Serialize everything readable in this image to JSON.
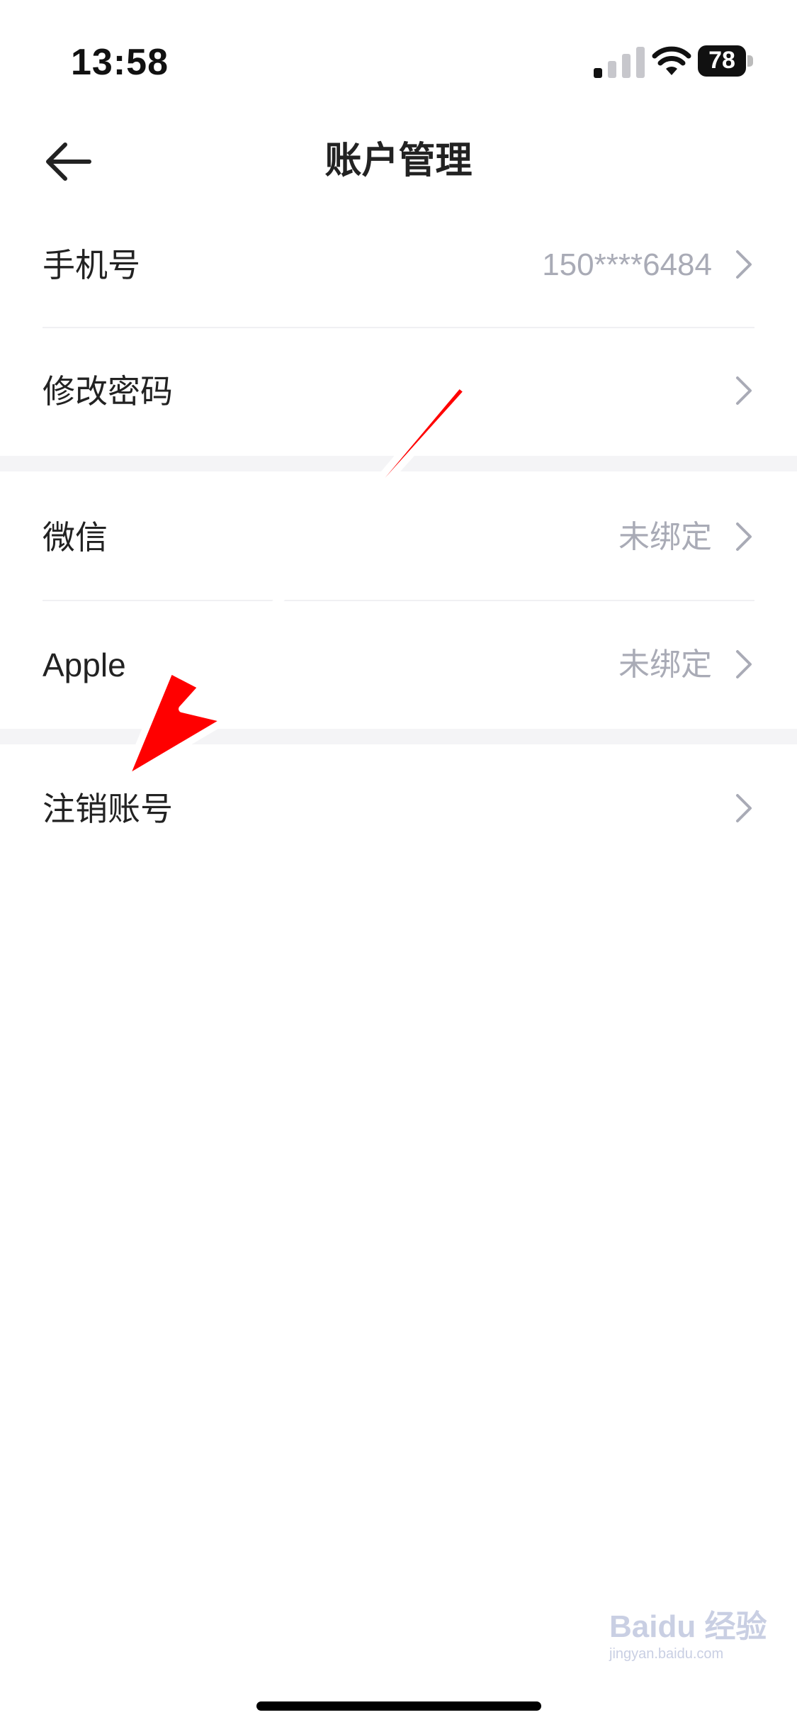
{
  "status_bar": {
    "time": "13:58",
    "battery_level": "78"
  },
  "nav": {
    "title": "账户管理"
  },
  "rows": [
    {
      "label": "手机号",
      "value": "150****6484"
    },
    {
      "label": "修改密码",
      "value": ""
    },
    {
      "label": "微信",
      "value": "未绑定"
    },
    {
      "label": "Apple",
      "value": "未绑定"
    },
    {
      "label": "注销账号",
      "value": ""
    }
  ],
  "watermark": {
    "text": "Baidu 经验",
    "subtext": "jingyan.baidu.com"
  },
  "colors": {
    "background": "#ffffff",
    "section_gap": "#f4f4f6",
    "secondary_text": "#a9abb6",
    "annotation_arrow": "#ff0000"
  }
}
